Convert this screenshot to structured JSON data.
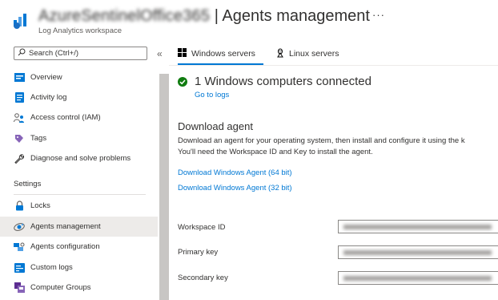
{
  "header": {
    "title_obscured": "AzureSentinelOffice365",
    "title_separator": " | ",
    "title_page": "Agents management",
    "subtitle": "Log Analytics workspace",
    "more": "···"
  },
  "sidebar": {
    "search_placeholder": "Search (Ctrl+/)",
    "collapse": "«",
    "items": [
      {
        "label": "Overview",
        "icon": "overview-icon"
      },
      {
        "label": "Activity log",
        "icon": "activity-log-icon"
      },
      {
        "label": "Access control (IAM)",
        "icon": "people-icon"
      },
      {
        "label": "Tags",
        "icon": "tag-icon"
      },
      {
        "label": "Diagnose and solve problems",
        "icon": "wrench-icon"
      }
    ],
    "section_settings": "Settings",
    "settings_items": [
      {
        "label": "Locks",
        "icon": "lock-icon"
      },
      {
        "label": "Agents management",
        "icon": "agents-icon",
        "active": true
      },
      {
        "label": "Agents configuration",
        "icon": "agents-config-icon"
      },
      {
        "label": "Custom logs",
        "icon": "custom-logs-icon"
      },
      {
        "label": "Computer Groups",
        "icon": "computer-groups-icon"
      }
    ]
  },
  "tabs": [
    {
      "label": "Windows servers",
      "icon": "windows-icon",
      "selected": true
    },
    {
      "label": "Linux servers",
      "icon": "linux-icon",
      "selected": false
    }
  ],
  "main": {
    "status_text": "1 Windows computers connected",
    "go_to_logs": "Go to logs",
    "download_title": "Download agent",
    "download_desc_1": "Download an agent for your operating system, then install and configure it using the k",
    "download_desc_2": "You'll need the Workspace ID and Key to install the agent.",
    "link_64": "Download Windows Agent (64 bit)",
    "link_32": "Download Windows Agent (32 bit)",
    "fields": [
      {
        "label": "Workspace ID"
      },
      {
        "label": "Primary key"
      },
      {
        "label": "Secondary key"
      }
    ]
  },
  "colors": {
    "accent": "#0078d4",
    "success": "#107c10",
    "active_bg": "#edebe9"
  }
}
